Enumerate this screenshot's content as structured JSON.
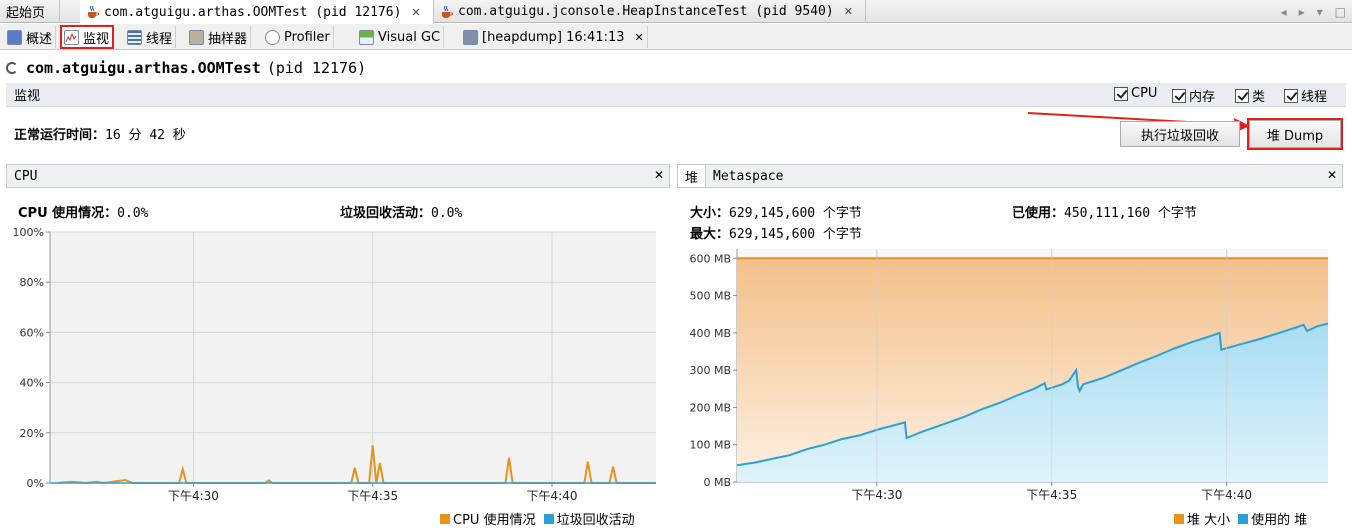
{
  "top_tabs": [
    {
      "label": "起始页"
    },
    {
      "label": "com.atguigu.arthas.OOMTest (pid 12176)"
    },
    {
      "label": "com.atguigu.jconsole.HeapInstanceTest (pid 9540)"
    }
  ],
  "sub_tabs": [
    {
      "label": "概述",
      "icon": "overview-icon"
    },
    {
      "label": "监视",
      "icon": "monitor-icon"
    },
    {
      "label": "线程",
      "icon": "threads-icon"
    },
    {
      "label": "抽样器",
      "icon": "sampler-icon"
    },
    {
      "label": "Profiler",
      "icon": "profiler-icon"
    },
    {
      "label": "Visual GC",
      "icon": "visualgc-icon"
    },
    {
      "label": "[heapdump] 16:41:13",
      "icon": "heapdump-icon"
    }
  ],
  "process": {
    "name": "com.atguigu.arthas.OOMTest",
    "pid": "(pid 12176)"
  },
  "monitor_bar": {
    "label": "监视",
    "checks": [
      {
        "label": "CPU",
        "checked": true
      },
      {
        "label": "内存",
        "checked": true
      },
      {
        "label": "类",
        "checked": true
      },
      {
        "label": "线程",
        "checked": true
      }
    ]
  },
  "uptime": {
    "label": "正常运行时间：",
    "value": "16 分 42 秒"
  },
  "buttons": {
    "gc": "执行垃圾回收",
    "dump": "堆 Dump"
  },
  "cpu_panel": {
    "title": "CPU",
    "usage_label": "CPU 使用情况：",
    "usage_value": "0.0%",
    "gc_label": "垃圾回收活动：",
    "gc_value": "0.0%",
    "legend": [
      {
        "label": "CPU 使用情况",
        "color": "#e8921a"
      },
      {
        "label": "垃圾回收活动",
        "color": "#2aa0d8"
      }
    ]
  },
  "heap_panel": {
    "tabs": [
      "堆",
      "Metaspace"
    ],
    "size_label": "大小：",
    "size_value": "629,145,600 个字节",
    "max_label": "最大：",
    "max_value": "629,145,600 个字节",
    "used_label": "已使用：",
    "used_value": "450,111,160 个字节",
    "legend": [
      {
        "label": "堆 大小",
        "color": "#e8921a"
      },
      {
        "label": "使用的 堆",
        "color": "#2aa0d8"
      }
    ]
  },
  "chart_data": [
    {
      "type": "line",
      "title": "CPU",
      "ylabel": "",
      "ylim": [
        0,
        100
      ],
      "y_ticks": [
        "0%",
        "20%",
        "40%",
        "60%",
        "80%",
        "100%"
      ],
      "x_ticks": [
        "下午4:30",
        "下午4:35",
        "下午4:40"
      ],
      "xlim_minutes": [
        26.0,
        42.9
      ],
      "x_tick_minutes": [
        30,
        35,
        40
      ],
      "series": [
        {
          "name": "CPU 使用情况",
          "color": "#e8921a",
          "points": [
            [
              26.2,
              0
            ],
            [
              26.6,
              0.5
            ],
            [
              27.0,
              0
            ],
            [
              27.3,
              0.5
            ],
            [
              27.5,
              0
            ],
            [
              28.1,
              1.2
            ],
            [
              28.3,
              0
            ],
            [
              29.6,
              0
            ],
            [
              29.7,
              5.5
            ],
            [
              29.8,
              0
            ],
            [
              32.0,
              0
            ],
            [
              32.1,
              1
            ],
            [
              32.2,
              0
            ],
            [
              34.4,
              0
            ],
            [
              34.5,
              6
            ],
            [
              34.6,
              0
            ],
            [
              34.9,
              0
            ],
            [
              35.0,
              15
            ],
            [
              35.1,
              0
            ],
            [
              35.2,
              8
            ],
            [
              35.3,
              0
            ],
            [
              38.7,
              0
            ],
            [
              38.8,
              10
            ],
            [
              38.9,
              0
            ],
            [
              40.9,
              0
            ],
            [
              41.0,
              8.5
            ],
            [
              41.1,
              0
            ],
            [
              41.6,
              0
            ],
            [
              41.7,
              6.5
            ],
            [
              41.8,
              0
            ],
            [
              42.9,
              0
            ]
          ]
        },
        {
          "name": "垃圾回收活动",
          "color": "#2aa0d8",
          "points": [
            [
              26.0,
              0
            ],
            [
              42.9,
              0
            ]
          ]
        }
      ]
    },
    {
      "type": "area",
      "title": "堆",
      "ylim": [
        0,
        625
      ],
      "y_ticks": [
        "0 MB",
        "100 MB",
        "200 MB",
        "300 MB",
        "400 MB",
        "500 MB",
        "600 MB"
      ],
      "x_ticks": [
        "下午4:30",
        "下午4:35",
        "下午4:40"
      ],
      "xlim_minutes": [
        26.0,
        42.9
      ],
      "x_tick_minutes": [
        30,
        35,
        40
      ],
      "series": [
        {
          "name": "堆 大小",
          "color": "#e8921a",
          "points": [
            [
              26.0,
              600
            ],
            [
              42.9,
              600
            ]
          ]
        },
        {
          "name": "使用的 堆",
          "color": "#2aa0d8",
          "points": [
            [
              26.0,
              45
            ],
            [
              26.5,
              52
            ],
            [
              27.0,
              62
            ],
            [
              27.5,
              72
            ],
            [
              28.0,
              88
            ],
            [
              28.5,
              100
            ],
            [
              29.0,
              115
            ],
            [
              29.5,
              125
            ],
            [
              30.0,
              140
            ],
            [
              30.4,
              150
            ],
            [
              30.8,
              160
            ],
            [
              30.85,
              118
            ],
            [
              31.3,
              135
            ],
            [
              32.0,
              158
            ],
            [
              32.5,
              175
            ],
            [
              33.0,
              195
            ],
            [
              33.5,
              212
            ],
            [
              34.0,
              232
            ],
            [
              34.5,
              250
            ],
            [
              34.8,
              265
            ],
            [
              34.85,
              248
            ],
            [
              35.3,
              262
            ],
            [
              35.5,
              272
            ],
            [
              35.7,
              300
            ],
            [
              35.75,
              255
            ],
            [
              35.8,
              245
            ],
            [
              35.9,
              262
            ],
            [
              36.5,
              280
            ],
            [
              37.0,
              300
            ],
            [
              37.5,
              320
            ],
            [
              38.0,
              338
            ],
            [
              38.5,
              358
            ],
            [
              39.0,
              375
            ],
            [
              39.5,
              390
            ],
            [
              39.8,
              400
            ],
            [
              39.85,
              355
            ],
            [
              40.5,
              372
            ],
            [
              41.0,
              385
            ],
            [
              41.5,
              400
            ],
            [
              42.0,
              415
            ],
            [
              42.2,
              422
            ],
            [
              42.3,
              405
            ],
            [
              42.6,
              418
            ],
            [
              42.9,
              425
            ]
          ]
        }
      ]
    }
  ]
}
